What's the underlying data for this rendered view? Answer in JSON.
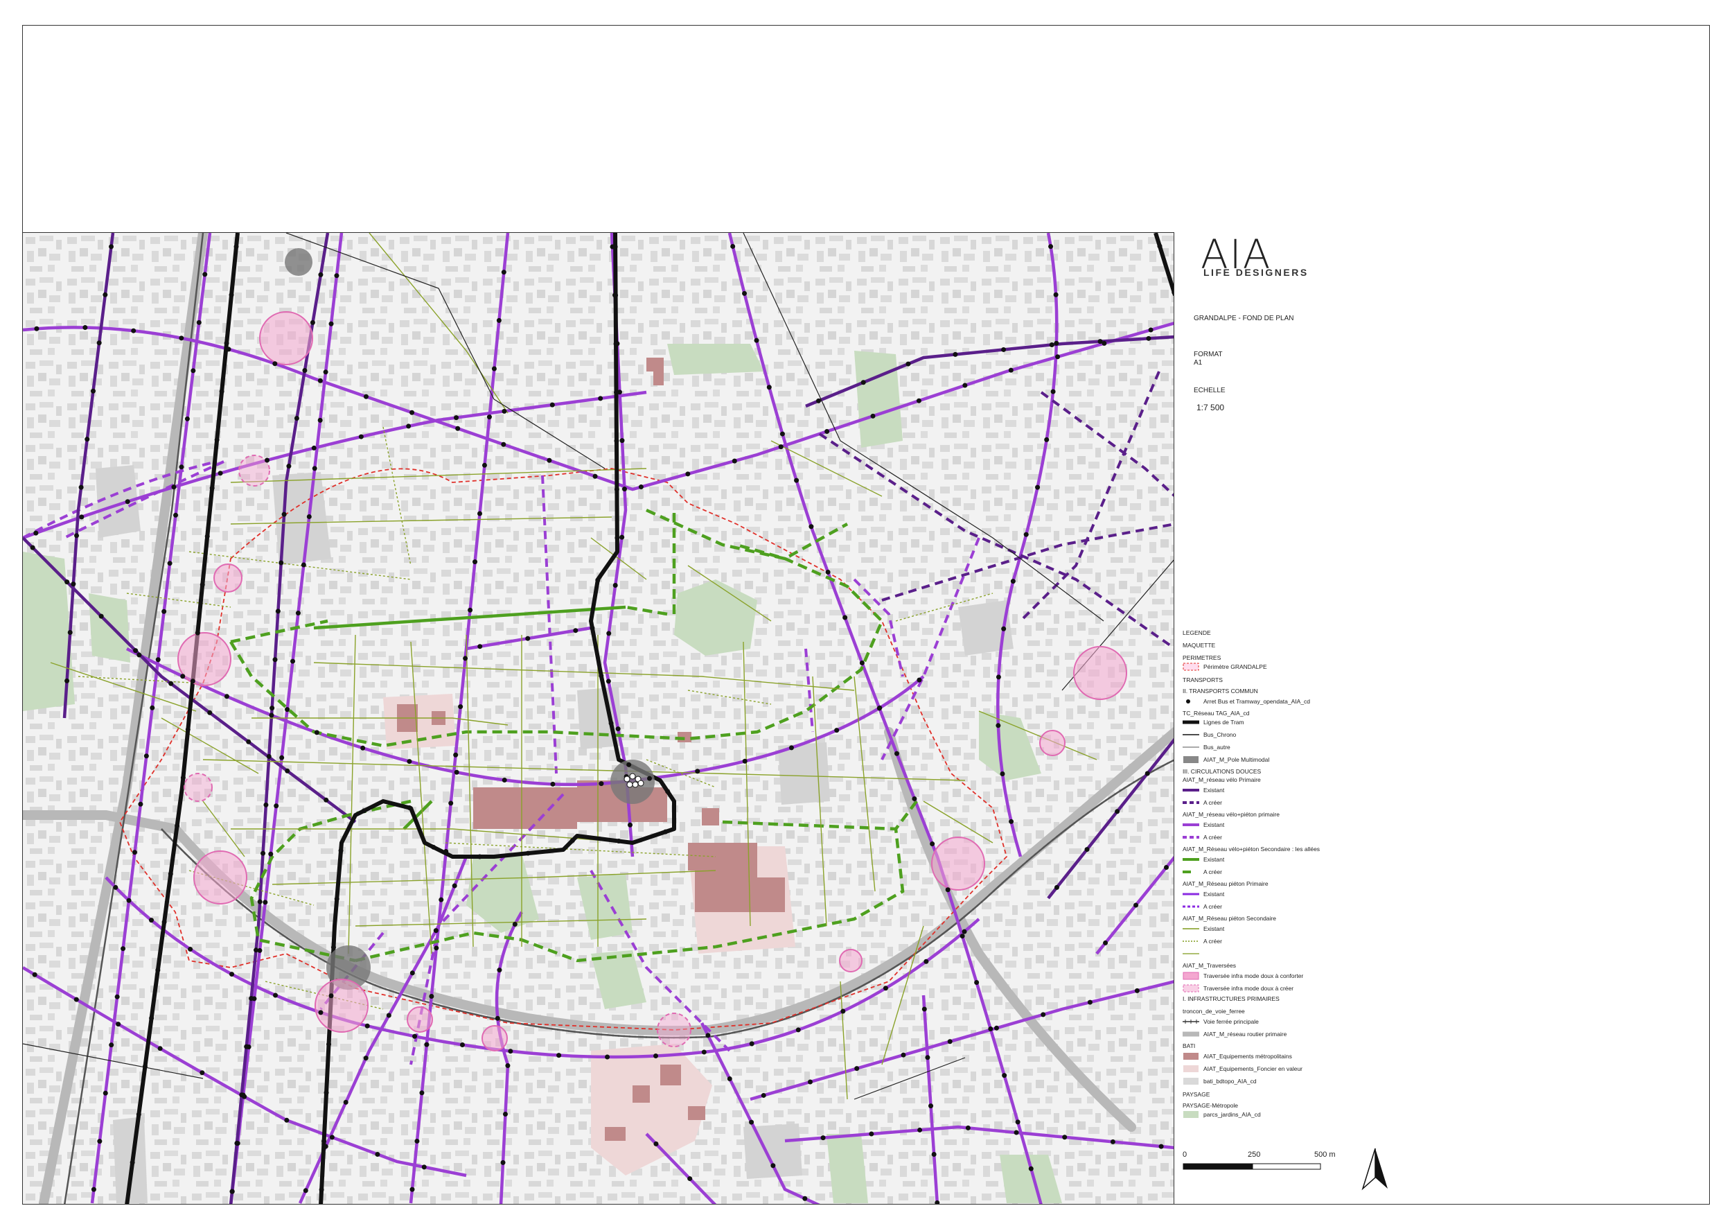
{
  "logo": {
    "mark": "AIA",
    "subtitle": "LIFE DESIGNERS"
  },
  "project": {
    "title": "GRANDALPE - FOND DE PLAN",
    "format_label": "FORMAT",
    "format_value": "A1",
    "scale_label": "ECHELLE",
    "scale_value": "1:7 500"
  },
  "legend": {
    "title": "LEGENDE",
    "maquette": "MAQUETTE",
    "perimetres": "PERIMETRES",
    "perimetre_grandalpe": "Périmètre GRANDALPE",
    "transports": "TRANSPORTS",
    "transports_commun": "II. TRANSPORTS COMMUN",
    "arret": "Arret Bus et Tramway_opendata_AIA_cd",
    "tc_reseau": "TC_Réseau TAG_AIA_cd",
    "tram": "Lignes de Tram",
    "bus_chrono": "Bus_Chrono",
    "bus_autre": "Bus_autre",
    "pole": "AIAT_M_Pole Multimodal",
    "circulations": "III. CIRCULATIONS DOUCES",
    "velo_primaire": "AIAT_M_réseau vélo Primaire",
    "existant": "Existant",
    "a_creer": "A créer",
    "velo_pieton_primaire": "AIAT_M_réseau vélo+piéton primaire",
    "velo_pieton_secondaire": "AIAT_M_Réseau vélo+piéton Secondaire : les allées",
    "pieton_primaire": "AIAT_M_Réseau piéton Primaire",
    "pieton_secondaire": "AIAT_M_Réseau piéton Secondaire",
    "traversees": "AIAT_M_Traversées",
    "traversee_conforter": "Traversée infra mode doux à conforter",
    "traversee_creer": "Traversée infra mode doux à créer",
    "infra_primaires": "I. INFRASTRUCTURES PRIMAIRES",
    "troncon": "troncon_de_voie_ferree",
    "voie_ferree": "Voie ferrée principale",
    "routier": "AIAT_M_réseau routier primaire",
    "bati": "BATI",
    "equip_metro": "AIAT_Equipements métropolitains",
    "equip_foncier": "AIAT_Equipements_Foncier en valeur",
    "bati_bdtopo": "bati_bdtopo_AIA_cd",
    "paysage": "PAYSAGE",
    "paysage_metropole": "PAYSAGE-Métropole",
    "parcs": "parcs_jardins_AIA_cd"
  },
  "scalebar": {
    "left": "0",
    "mid": "250",
    "right": "500 m"
  },
  "colors": {
    "tram": "#111111",
    "velo_primaire": "#5a1f8a",
    "velo_pieton": "#9b3fd4",
    "allees": "#4ea01f",
    "pieton_secondaire": "#7e9a1a",
    "perimetre": "#e0302a",
    "traversee": "#f4a7d0",
    "routier": "#b8b8b8",
    "equip_metro": "#c08a8a",
    "equip_foncier": "#eed7d7",
    "parcs": "#c8dcc0"
  }
}
